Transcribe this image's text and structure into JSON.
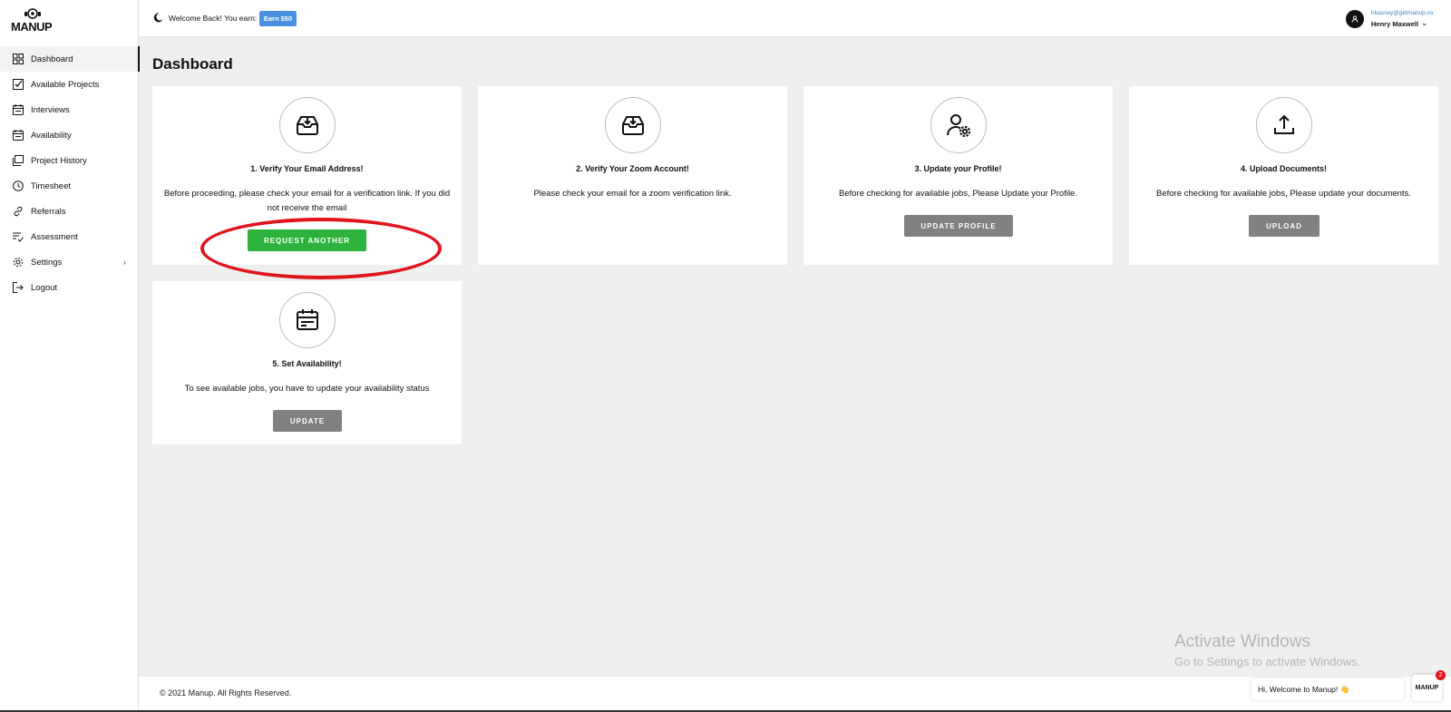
{
  "brand": {
    "name": "MANUP"
  },
  "topbar": {
    "welcome": "Welcome Back! You earn:",
    "earn_badge": "Earn $50",
    "user_email": "hbassey@getmanup.co",
    "user_name": "Henry Maxwell",
    "badge_color": "#4a90e2"
  },
  "sidebar": {
    "items": [
      {
        "label": "Dashboard",
        "icon": "grid-icon",
        "active": true
      },
      {
        "label": "Available Projects",
        "icon": "checklist-icon"
      },
      {
        "label": "Interviews",
        "icon": "calendar-icon"
      },
      {
        "label": "Availability",
        "icon": "calendar-icon"
      },
      {
        "label": "Project History",
        "icon": "folders-icon"
      },
      {
        "label": "Timesheet",
        "icon": "clock-icon"
      },
      {
        "label": "Referrals",
        "icon": "link-icon"
      },
      {
        "label": "Assessment",
        "icon": "list-check-icon"
      },
      {
        "label": "Settings",
        "icon": "gear-icon",
        "has_submenu": true
      },
      {
        "label": "Logout",
        "icon": "logout-icon"
      }
    ]
  },
  "main": {
    "title": "Dashboard",
    "cards": [
      {
        "title": "1. Verify Your Email Address!",
        "text": "Before proceeding, please check your email for a verification link. If you did not receive the email",
        "button": "REQUEST ANOTHER",
        "icon": "inbox-download-icon"
      },
      {
        "title": "2. Verify Your Zoom Account!",
        "text": "Please check your email for a zoom verification link.",
        "icon": "inbox-download-icon"
      },
      {
        "title": "3. Update your Profile!",
        "text": "Before checking for available jobs, Please Update your Profile.",
        "button": "UPDATE PROFILE",
        "icon": "user-gear-icon"
      },
      {
        "title": "4. Upload Documents!",
        "text": "Before checking for available jobs, Please update your documents.",
        "button": "UPLOAD",
        "icon": "upload-icon"
      },
      {
        "title": "5. Set Availability!",
        "text": "To see available jobs, you have to update your availability status",
        "button": "UPDATE",
        "icon": "calendar-icon"
      }
    ]
  },
  "footer": {
    "copyright": "© 2021 Manup. All Rights Reserved."
  },
  "os_watermark": {
    "line1": "Activate Windows",
    "line2": "Go to Settings to activate Windows."
  },
  "chat": {
    "message": "Hi, Welcome to Manup! 👋",
    "badge_count": "2",
    "launcher_text": "MANUP"
  }
}
